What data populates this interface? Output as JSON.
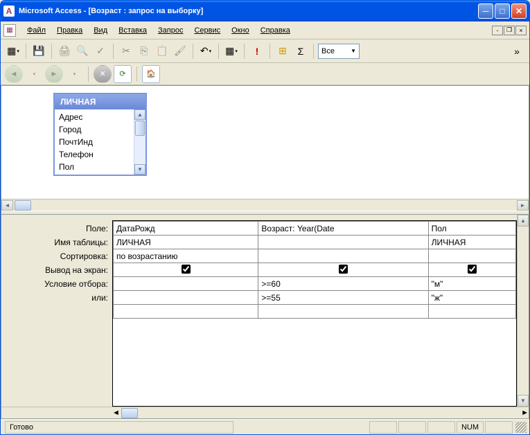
{
  "titlebar": {
    "text": "Microsoft Access - [Возраст : запрос на выборку]",
    "app_icon_letter": "A"
  },
  "menu": {
    "file": "Файл",
    "edit": "Правка",
    "view": "Вид",
    "insert": "Вставка",
    "query": "Запрос",
    "tools": "Сервис",
    "window": "Окно",
    "help": "Справка"
  },
  "toolbar": {
    "combo_value": "Все"
  },
  "table_box": {
    "title": "ЛИЧНАЯ",
    "fields": [
      "Адрес",
      "Город",
      "ПочтИнд",
      "Телефон",
      "Пол"
    ]
  },
  "design_grid": {
    "labels": {
      "field": "Поле:",
      "table": "Имя таблицы:",
      "sort": "Сортировка:",
      "show": "Вывод на экран:",
      "criteria": "Условие отбора:",
      "or": "или:"
    },
    "cols": [
      {
        "field": "ДатаРожд",
        "table": "ЛИЧНАЯ",
        "sort": "по возрастанию",
        "show": true,
        "criteria": "",
        "or": ""
      },
      {
        "field": "Возраст: Year(Date",
        "table": "",
        "sort": "",
        "show": true,
        "criteria": ">=60",
        "or": ">=55"
      },
      {
        "field": "Пол",
        "table": "ЛИЧНАЯ",
        "sort": "",
        "show": true,
        "criteria": "\"м\"",
        "or": "\"ж\""
      }
    ]
  },
  "statusbar": {
    "ready": "Готово",
    "num": "NUM"
  }
}
